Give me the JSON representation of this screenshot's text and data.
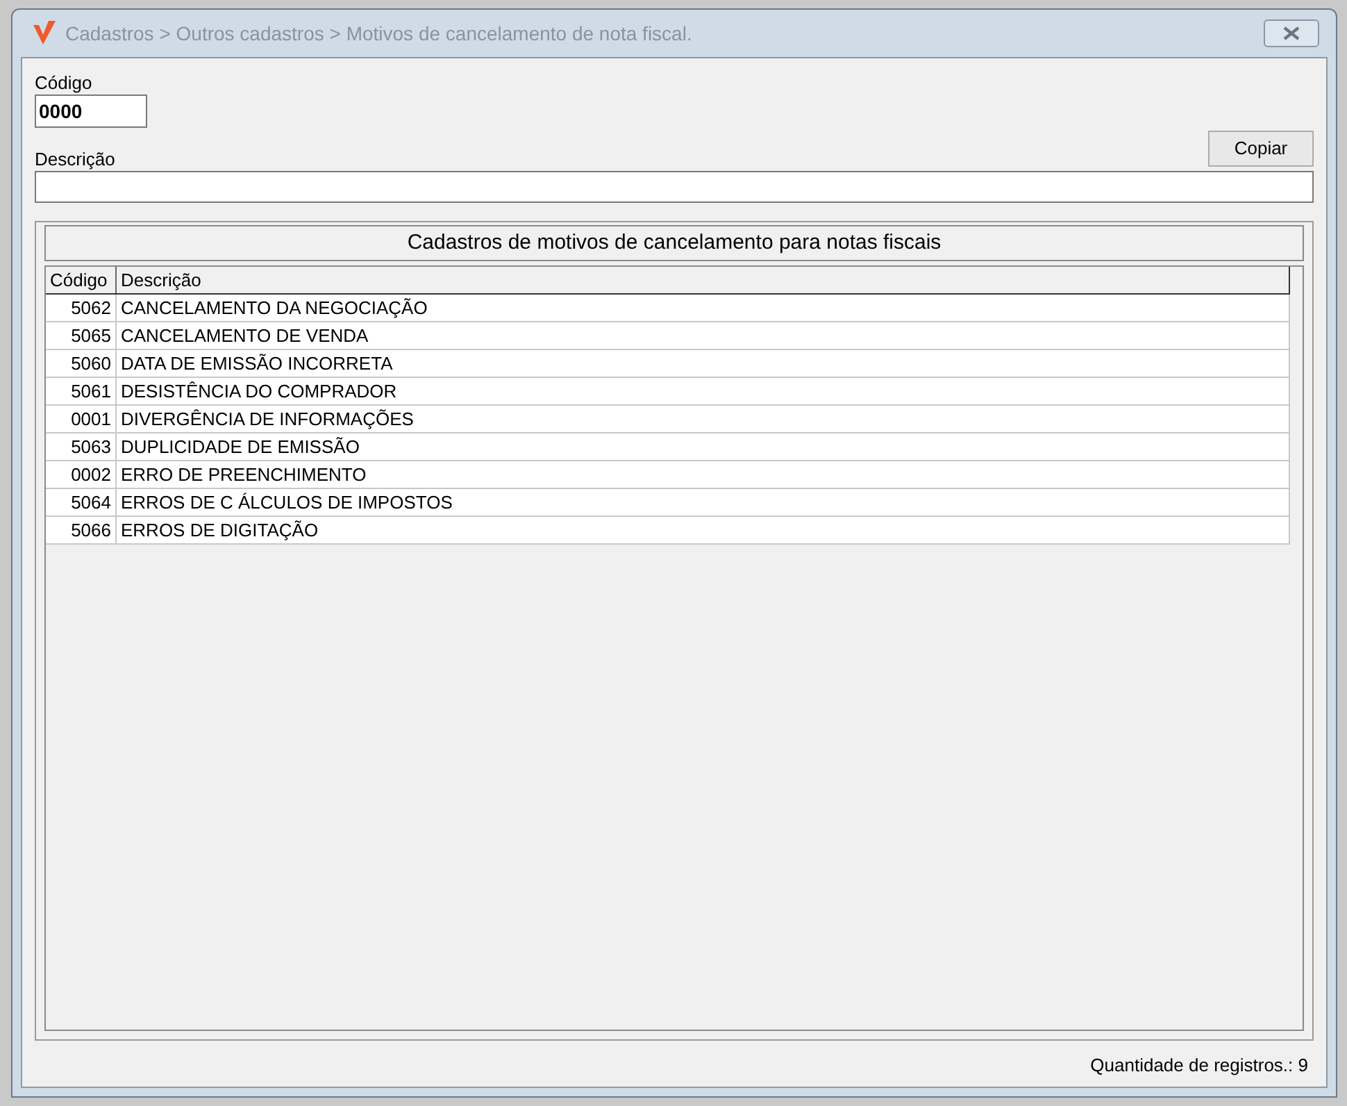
{
  "window": {
    "title": "Cadastros > Outros cadastros > Motivos de cancelamento de nota fiscal."
  },
  "form": {
    "code_label": "Código",
    "code_value": "0000",
    "description_label": "Descrição",
    "copy_button": "Copiar"
  },
  "table": {
    "title": "Cadastros de motivos de cancelamento para notas fiscais",
    "columns": [
      "Código",
      "Descrição"
    ],
    "rows": [
      {
        "code": "5062",
        "description": "CANCELAMENTO DA NEGOCIAÇÃO"
      },
      {
        "code": "5065",
        "description": "CANCELAMENTO DE VENDA"
      },
      {
        "code": "5060",
        "description": "DATA DE EMISSÃO INCORRETA"
      },
      {
        "code": "5061",
        "description": "DESISTÊNCIA DO COMPRADOR"
      },
      {
        "code": "0001",
        "description": "DIVERGÊNCIA DE INFORMAÇÕES"
      },
      {
        "code": "5063",
        "description": "DUPLICIDADE DE EMISSÃO"
      },
      {
        "code": "0002",
        "description": "ERRO DE PREENCHIMENTO"
      },
      {
        "code": "5064",
        "description": "ERROS DE C ÁLCULOS DE IMPOSTOS"
      },
      {
        "code": "5066",
        "description": "ERROS DE DIGITAÇÃO"
      }
    ]
  },
  "status_bar": {
    "count": "Quantidade de registros.: 9"
  }
}
